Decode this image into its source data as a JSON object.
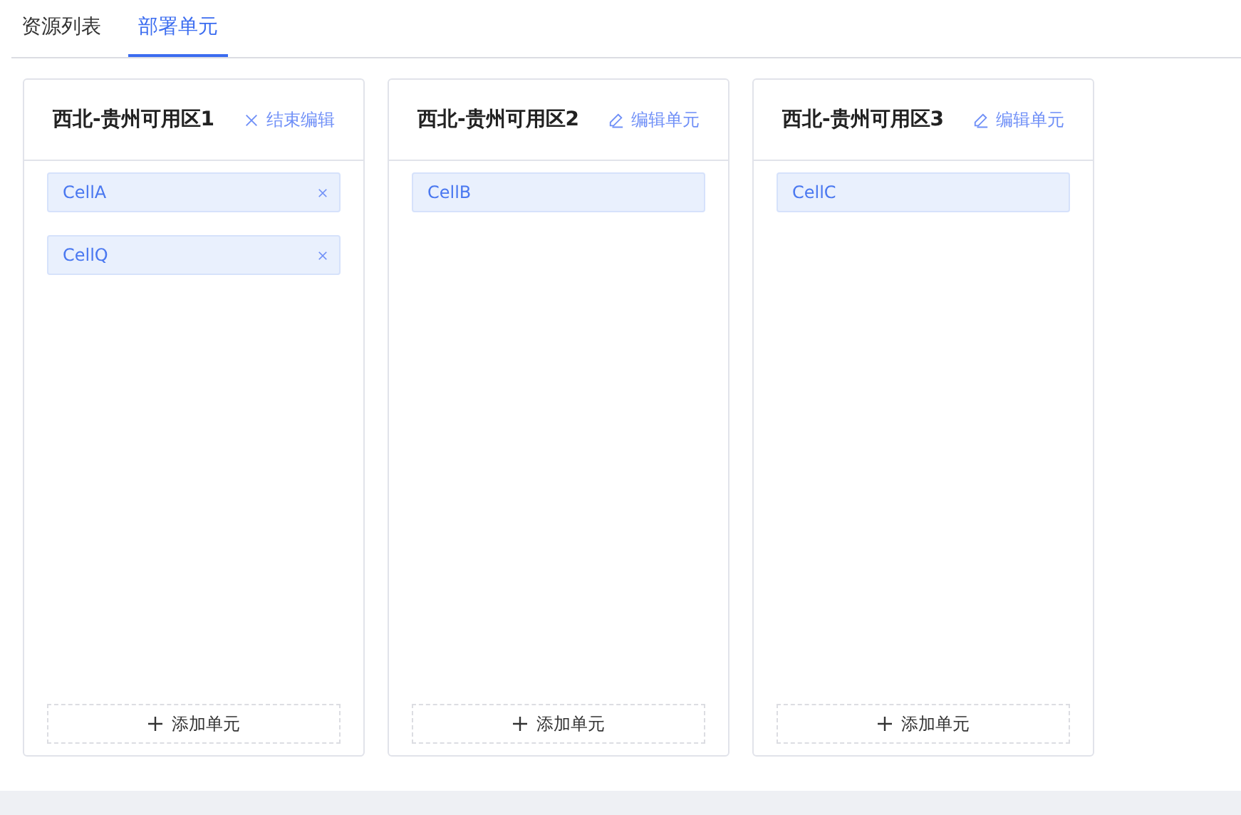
{
  "tabs": [
    {
      "label": "资源列表",
      "selected": false
    },
    {
      "label": "部署单元",
      "selected": true
    }
  ],
  "zones": [
    {
      "title": "西北-贵州可用区1",
      "editing": true,
      "action": "结束编辑",
      "cells": [
        "CellA",
        "CellQ"
      ],
      "add_label": "添加单元"
    },
    {
      "title": "西北-贵州可用区2",
      "editing": false,
      "action": "编辑单元",
      "cells": [
        "CellB"
      ],
      "add_label": "添加单元"
    },
    {
      "title": "西北-贵州可用区3",
      "editing": false,
      "action": "编辑单元",
      "cells": [
        "CellC"
      ],
      "add_label": "添加单元"
    }
  ]
}
